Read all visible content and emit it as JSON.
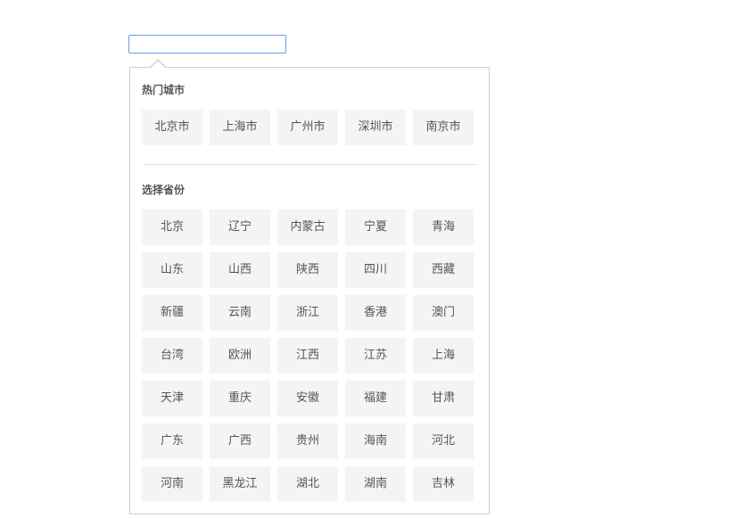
{
  "search": {
    "value": "",
    "placeholder": ""
  },
  "popup": {
    "hot_title": "热门城市",
    "hot_cities": [
      "北京市",
      "上海市",
      "广州市",
      "深圳市",
      "南京市"
    ],
    "province_title": "选择省份",
    "provinces": [
      "北京",
      "辽宁",
      "内蒙古",
      "宁夏",
      "青海",
      "山东",
      "山西",
      "陕西",
      "四川",
      "西藏",
      "新疆",
      "云南",
      "浙江",
      "香港",
      "澳门",
      "台湾",
      "欧洲",
      "江西",
      "江苏",
      "上海",
      "天津",
      "重庆",
      "安徽",
      "福建",
      "甘肃",
      "广东",
      "广西",
      "贵州",
      "海南",
      "河北",
      "河南",
      "黑龙江",
      "湖北",
      "湖南",
      "吉林"
    ]
  },
  "colors": {
    "input_border": "#6b9be8",
    "popup_border": "#cfcfcf",
    "item_bg": "#f4f4f4",
    "text": "#555555"
  }
}
